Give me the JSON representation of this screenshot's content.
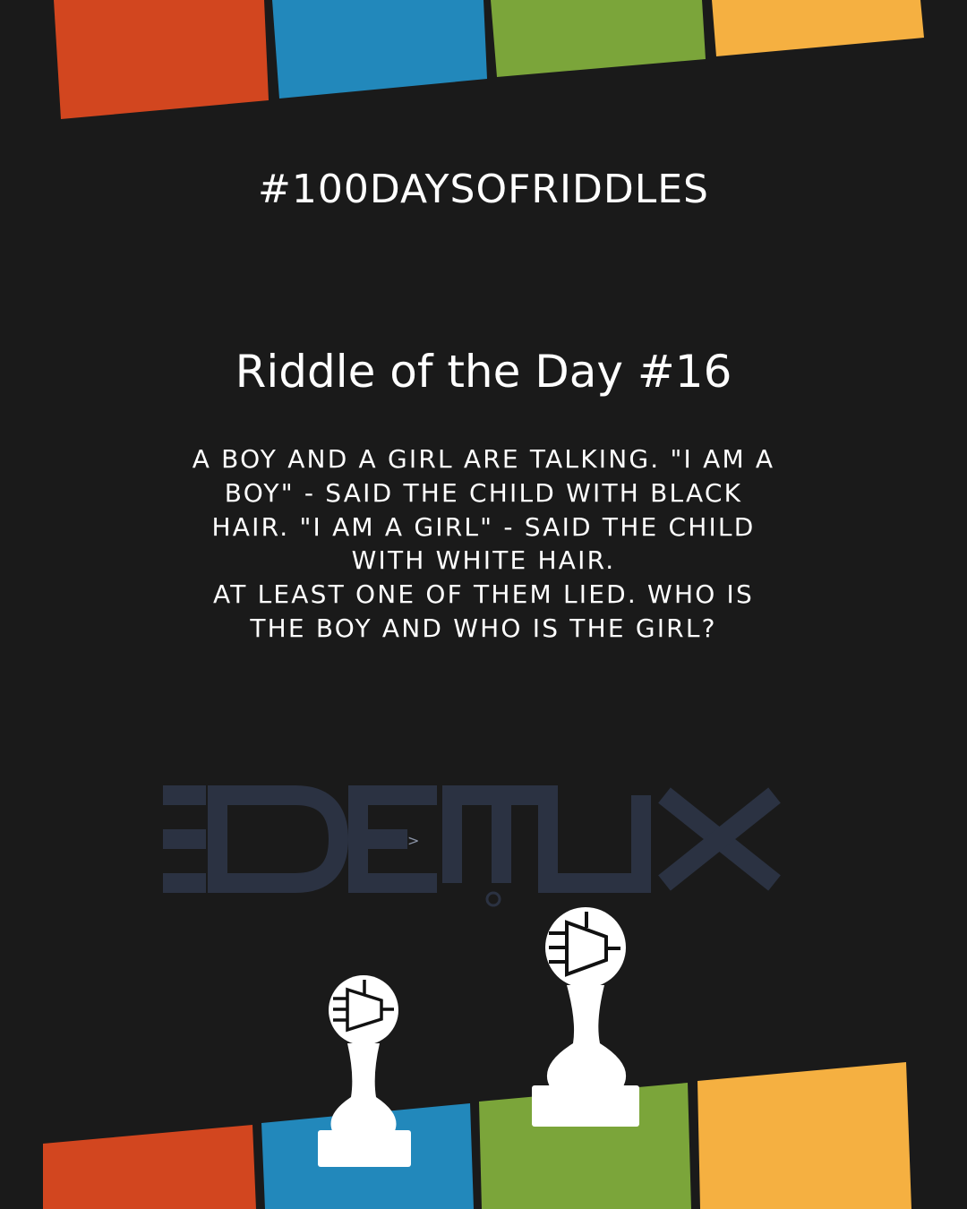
{
  "hashtag": "#100DAYSOFRIDDLES",
  "title": "Riddle of the Day #16",
  "riddle_lines": [
    "A BOY AND A GIRL ARE TALKING. \"I AM A",
    "BOY\" - SAID THE CHILD WITH BLACK",
    "HAIR. \"I AM A GIRL\"  - SAID THE CHILD",
    "WITH WHITE HAIR.",
    "AT LEAST ONE OF THEM LIED. WHO IS",
    "THE BOY AND WHO IS THE GIRL?"
  ],
  "logo_text": "DEMUX",
  "colors": {
    "background": "#1a1a1a",
    "red": "#d2461f",
    "blue": "#2288bb",
    "green": "#7ba53a",
    "yellow": "#f5b041",
    "logo": "#2b3242"
  },
  "icons": [
    "demux-logo-icon",
    "chess-pawn-icon",
    "demux-symbol-icon"
  ]
}
